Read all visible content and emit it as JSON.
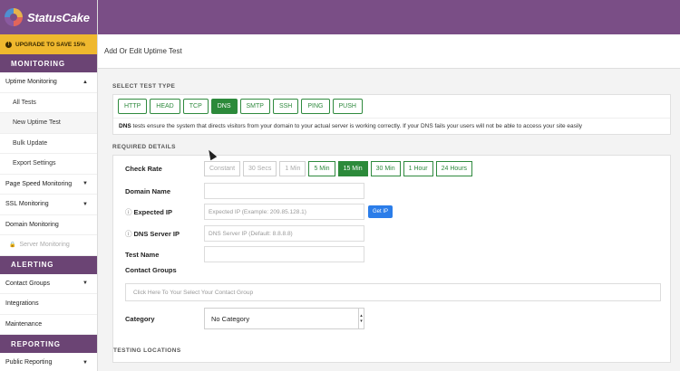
{
  "brand": {
    "name": "StatusCake"
  },
  "sidebar": {
    "upgrade_label": "UPGRADE TO SAVE 15%",
    "sections": {
      "monitoring": "MONITORING",
      "alerting": "ALERTING",
      "reporting": "REPORTING"
    },
    "monitoring_items": [
      {
        "label": "Uptime Monitoring",
        "caret": "▲"
      },
      {
        "label": "All Tests"
      },
      {
        "label": "New Uptime Test"
      },
      {
        "label": "Bulk Update"
      },
      {
        "label": "Export Settings"
      },
      {
        "label": "Page Speed Monitoring",
        "caret": "▼"
      },
      {
        "label": "SSL Monitoring",
        "caret": "▼"
      },
      {
        "label": "Domain Monitoring"
      },
      {
        "label": "Server Monitoring"
      }
    ],
    "alerting_items": [
      {
        "label": "Contact Groups",
        "caret": "▼"
      },
      {
        "label": "Integrations"
      },
      {
        "label": "Maintenance"
      }
    ],
    "reporting_items": [
      {
        "label": "Public Reporting",
        "caret": "▼"
      }
    ]
  },
  "page": {
    "title": "Add Or Edit Uptime Test"
  },
  "test_type": {
    "heading": "SELECT TEST TYPE",
    "options": [
      "HTTP",
      "HEAD",
      "TCP",
      "DNS",
      "SMTP",
      "SSH",
      "PING",
      "PUSH"
    ],
    "selected": "DNS",
    "description_bold": "DNS",
    "description_text": " tests ensure the system that directs visitors from your domain to your actual server is working correctly. If your DNS fails your users will not be able to access your site easily"
  },
  "required": {
    "heading": "REQUIRED DETAILS",
    "check_rate_label": "Check Rate",
    "check_rates": [
      "Constant",
      "30 Secs",
      "1 Min",
      "5 Min",
      "15 Min",
      "30 Min",
      "1 Hour",
      "24 Hours"
    ],
    "check_rate_selected": "15 Min",
    "domain_label": "Domain Name",
    "domain_value": "",
    "expected_ip_label": "Expected IP",
    "expected_ip_placeholder": "Expected IP (Example: 209.85.128.1)",
    "get_ip_label": "Get IP",
    "dns_server_label": "DNS Server IP",
    "dns_server_placeholder": "DNS Server IP (Default: 8.8.8.8)",
    "test_name_label": "Test Name",
    "test_name_value": "",
    "contact_groups_label": "Contact Groups",
    "contact_groups_placeholder": "Click Here To Your Select Your Contact Group",
    "category_label": "Category",
    "category_value": "No Category",
    "info_icon": "ⓘ"
  },
  "locations": {
    "heading": "TESTING LOCATIONS"
  }
}
